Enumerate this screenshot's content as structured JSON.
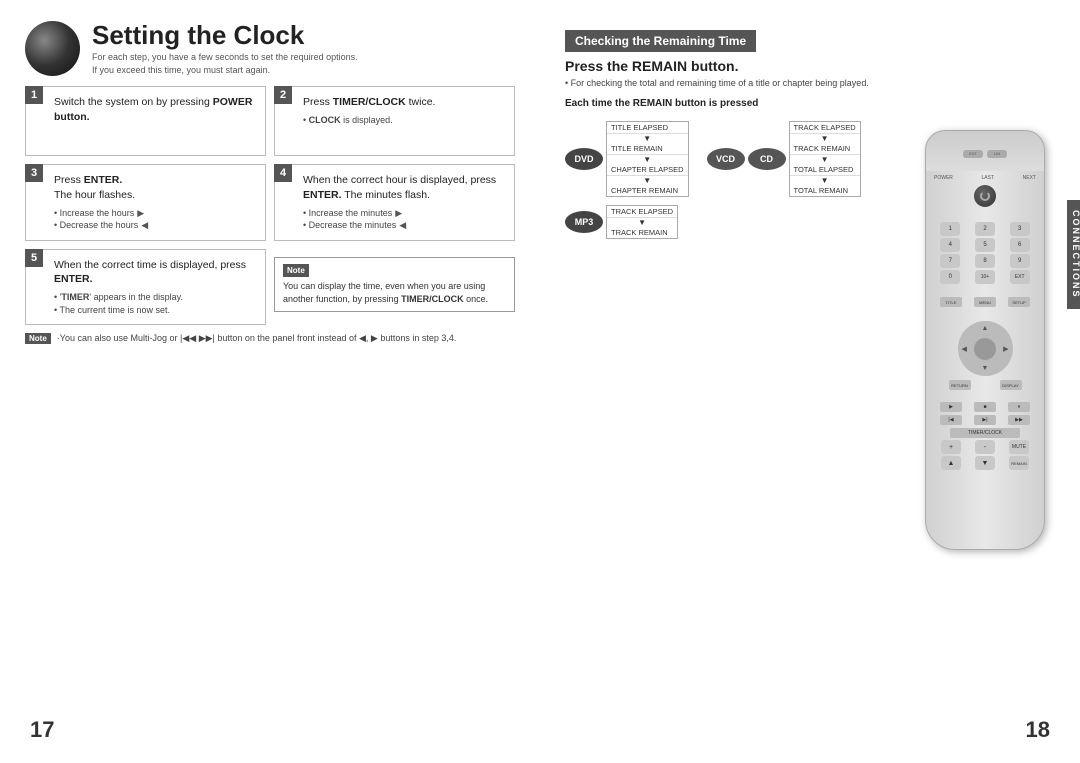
{
  "page": {
    "left_number": "17",
    "right_number": "18",
    "title": "Setting the Clock",
    "subtitle_line1": "For each step, you have a few seconds to set the required options.",
    "subtitle_line2": "If you exceed this time, you must start again.",
    "steps": [
      {
        "number": "1",
        "text": "Switch the system on by pressing POWER button.",
        "bold": "POWER button.",
        "bullets": []
      },
      {
        "number": "2",
        "text": "Press TIMER/CLOCK twice.",
        "bold": "TIMER/CLOCK",
        "sub": "• CLOCK is displayed.",
        "bullets": []
      },
      {
        "number": "3",
        "text": "Press ENTER. The hour flashes.",
        "bold": "ENTER.",
        "bullets": [
          "• Increase the hours ▶",
          "• Decrease the hours ◀"
        ]
      },
      {
        "number": "4",
        "text": "When the correct hour is displayed, press ENTER. The minutes flash.",
        "bold": "ENTER.",
        "bullets": [
          "• Increase the minutes ▶",
          "• Decrease the minutes ◀"
        ]
      },
      {
        "number": "5",
        "text": "When the correct time is displayed, press ENTER.",
        "bold": "ENTER.",
        "bullets": [
          "• 'TIMER' appears in the display.",
          "• The current time is now set."
        ]
      }
    ],
    "note": {
      "label": "Note",
      "text": "You can display the time, even when you are using another function, by pressing TIMER/CLOCK once."
    },
    "bottom_note": {
      "label": "Note",
      "text": "·You can also use Multi-Jog or |◀◀ ▶▶| button on the panel front instead of ◀, ▶ buttons in step 3,4."
    }
  },
  "right": {
    "checking_header": "Checking the Remaining Time",
    "remain_title": "Press the REMAIN button.",
    "remain_subtitle": "• For checking the total and remaining time of a title or chapter being played.",
    "remain_table_title": "Each time the REMAIN button is pressed",
    "devices": {
      "dvd": {
        "label": "DVD",
        "rows": [
          [
            "TITLE ELAPSED",
            "▼"
          ],
          [
            "TITLE REMAIN",
            ""
          ],
          [
            "CHAPTER ELAPSED",
            "▼"
          ],
          [
            "CHAPTER REMAIN",
            ""
          ]
        ]
      },
      "vcd": {
        "label": "VCD",
        "rows": [
          [
            "TRACK ELAPSED",
            "▼"
          ],
          [
            "TRACK REMAIN",
            ""
          ],
          [
            "TOTAL ELAPSED",
            "▼"
          ],
          [
            "TOTAL REMAIN",
            ""
          ]
        ]
      },
      "cd": {
        "label": "CD"
      },
      "mp3": {
        "label": "MP3",
        "rows": [
          [
            "TRACK ELAPSED",
            "▼"
          ],
          [
            "TRACK REMAIN",
            ""
          ]
        ]
      }
    },
    "connections_label": "CONNECTIONS"
  },
  "remote": {
    "buttons": [
      "POWER",
      "LAST",
      "NEXT"
    ],
    "num_buttons": [
      "1",
      "2",
      "3",
      "4",
      "5",
      "6",
      "7",
      "8",
      "9",
      "0",
      "10+",
      "EXT"
    ],
    "function_buttons": [
      "PLAY",
      "PAUSE",
      "STOP",
      "SKIP-",
      "SKIP+"
    ]
  }
}
